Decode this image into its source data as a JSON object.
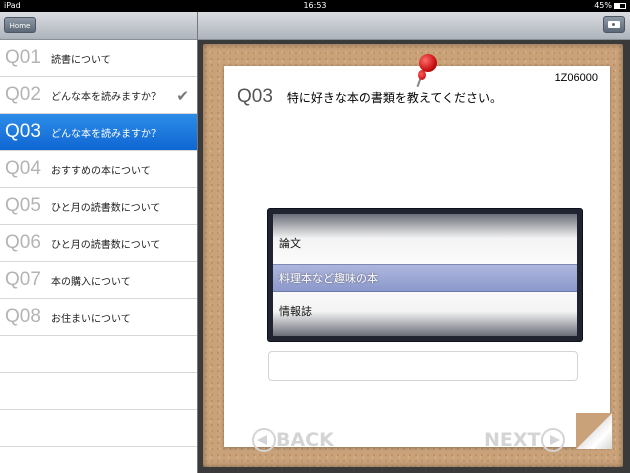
{
  "status": {
    "device": "iPad",
    "time": "16:53",
    "battery": "45%",
    "battery_level": 0.45
  },
  "sidebar": {
    "home_label": "Home",
    "items": [
      {
        "num": "Q01",
        "title": "読書について",
        "checked": false,
        "selected": false
      },
      {
        "num": "Q02",
        "title": "どんな本を読みますか？",
        "checked": true,
        "selected": false
      },
      {
        "num": "Q03",
        "title": "どんな本を読みますか？",
        "checked": false,
        "selected": true
      },
      {
        "num": "Q04",
        "title": "おすすめの本について",
        "checked": false,
        "selected": false
      },
      {
        "num": "Q05",
        "title": "ひと月の読書数について",
        "checked": false,
        "selected": false
      },
      {
        "num": "Q06",
        "title": "ひと月の読書数について",
        "checked": false,
        "selected": false
      },
      {
        "num": "Q07",
        "title": "本の購入について",
        "checked": false,
        "selected": false
      },
      {
        "num": "Q08",
        "title": "お住まいについて",
        "checked": false,
        "selected": false
      }
    ]
  },
  "main": {
    "code": "1Z06000",
    "question_num": "Q03",
    "question_text": "特に好きな本の書類を教えてください。",
    "picker": {
      "options": [
        "論文",
        "料理本など趣味の本",
        "情報誌"
      ],
      "selected": "料理本など趣味の本"
    },
    "answer_value": "",
    "back_label": "BACK",
    "next_label": "NEXT"
  },
  "icons": {
    "check": "checkmark-icon",
    "camera": "camera-icon",
    "pin": "pushpin-icon"
  },
  "colors": {
    "selected_row": "#1f7ae0",
    "cork": "#c9a27a"
  }
}
